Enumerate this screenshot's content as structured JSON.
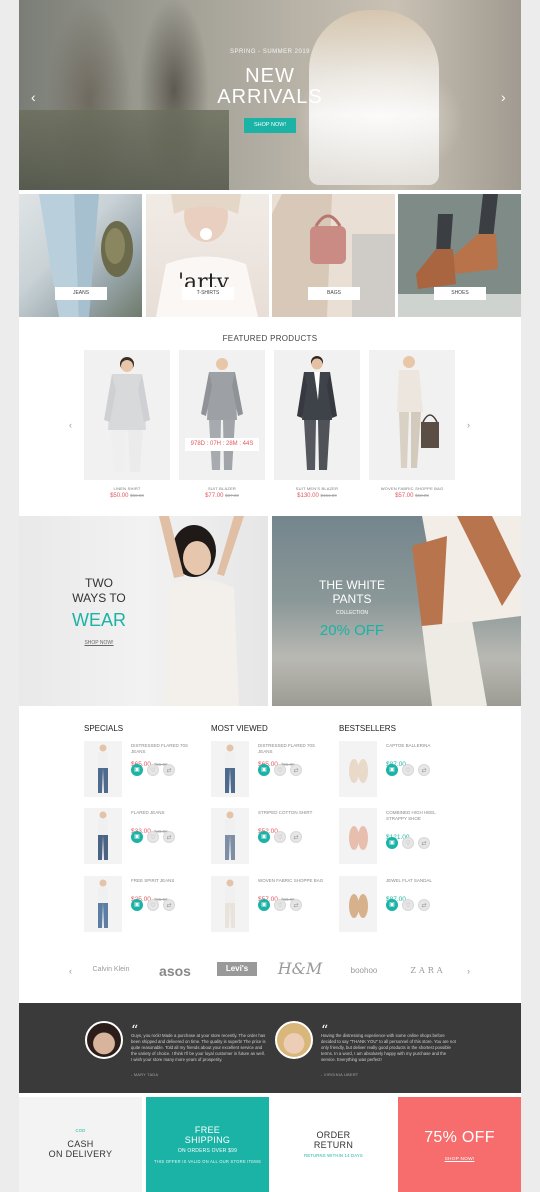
{
  "hero": {
    "kicker": "SPRING - SUMMER 2019",
    "title_line1": "NEW",
    "title_line2": "ARRIVALS",
    "button": "SHOP NOW!",
    "prev_arrow": "‹",
    "next_arrow": "›"
  },
  "categories": [
    {
      "label": "JEANS"
    },
    {
      "label": "T-SHIRTS"
    },
    {
      "label": "BAGS"
    },
    {
      "label": "SHOES"
    }
  ],
  "featured": {
    "title": "FEATURED PRODUCTS",
    "prev_arrow": "‹",
    "next_arrow": "›",
    "countdown": "978D : 07H : 28M : 44S",
    "products": [
      {
        "name": "LINEN SHIRT",
        "price": "$50.00",
        "old_price": "$69.00"
      },
      {
        "name": "SUIT BLAZER",
        "price": "$77.00",
        "old_price": "$87.00"
      },
      {
        "name": "SUIT MEN'S BLAZER",
        "price": "$130.00",
        "old_price": "$151.00"
      },
      {
        "name": "WOVEN FABRIC SHOPPE BAG",
        "price": "$57.00",
        "old_price": "$68.00"
      }
    ]
  },
  "banners": {
    "left": {
      "line1": "TWO",
      "line2": "WAYS TO",
      "line3": "WEAR",
      "link": "SHOP NOW!"
    },
    "right": {
      "line1": "THE WHITE",
      "line2": "PANTS",
      "line3": "COLLECTION",
      "line4": "20% OFF"
    }
  },
  "lists": {
    "specials": {
      "title": "SPECIALS",
      "items": [
        {
          "name": "DISTRESSED FLARED 70S JEANS",
          "price": "$65.00",
          "old_price": "$55.00"
        },
        {
          "name": "FLARED JEANS",
          "price": "$33.00",
          "old_price": "$40.00"
        },
        {
          "name": "FREE SPIRIT JEANS",
          "price": "$25.00",
          "old_price": "$55.00"
        }
      ]
    },
    "most_viewed": {
      "title": "MOST VIEWED",
      "items": [
        {
          "name": "DISTRESSED FLARED 70S JEANS",
          "price": "$65.00",
          "old_price": "$55.00"
        },
        {
          "name": "STRIPED COTTON SHIRT",
          "price": "$52.00",
          "old_price": ""
        },
        {
          "name": "WOVEN FABRIC SHOPPE BAG",
          "price": "$57.00",
          "old_price": "$68.00"
        }
      ]
    },
    "bestsellers": {
      "title": "BESTSELLERS",
      "items": [
        {
          "name": "CAPTOE BALLERINA",
          "price": "$87.00",
          "old_price": ""
        },
        {
          "name": "COMBINED HIGH HEEL STRAPPY SHOE",
          "price": "$121.00",
          "old_price": ""
        },
        {
          "name": "JEWEL FLAT SANDAL",
          "price": "$87.00",
          "old_price": ""
        }
      ]
    }
  },
  "brands": {
    "prev_arrow": "‹",
    "next_arrow": "›",
    "items": [
      "Calvin Klein",
      "asos",
      "Levi's",
      "H&M",
      "boohoo",
      "ZARA"
    ]
  },
  "testimonials": [
    {
      "text": "Guys, you rock! Made a purchase at your store recently. The order has been shipped and delivered on time. The quality is superb! The price is quite reasonable. Told all my friends about your excellent service and the variety of choice. I think I'll be your loyal customer in future as well. I wish your store many more years of prosperity.",
      "name": "- MARY TADA"
    },
    {
      "text": "Having the distressing experience with some online shops before decided to say \"THANK YOU\" to all personnel of this store. You are not only friendly, but deliver really good products in the shortest possible terms. In a word, I am absolutely happy with my purchase and the service. Everything was perfect!",
      "name": "- VIRGINIA UBERT"
    }
  ],
  "footer": [
    {
      "kicker": "COD",
      "line1": "CASH",
      "line2": "ON DELIVERY",
      "sub": ""
    },
    {
      "kicker": "",
      "line1": "FREE",
      "line2": "SHIPPING",
      "line3": "ON ORDERS OVER $99",
      "sub": "THIS OFFER IS VALID ON ALL OUR STORE ITEMS"
    },
    {
      "kicker": "",
      "line1": "ORDER",
      "line2": "RETURN",
      "sub": "RETURNS WITHIN 14 DAYS"
    },
    {
      "kicker": "",
      "line1": "75% OFF",
      "line2": "",
      "sub": "SHOP NOW!"
    }
  ],
  "colors": {
    "teal": "#1ab3a6",
    "red": "#e1575d",
    "coral": "#f76c6c",
    "dark": "#3a3a3a"
  }
}
